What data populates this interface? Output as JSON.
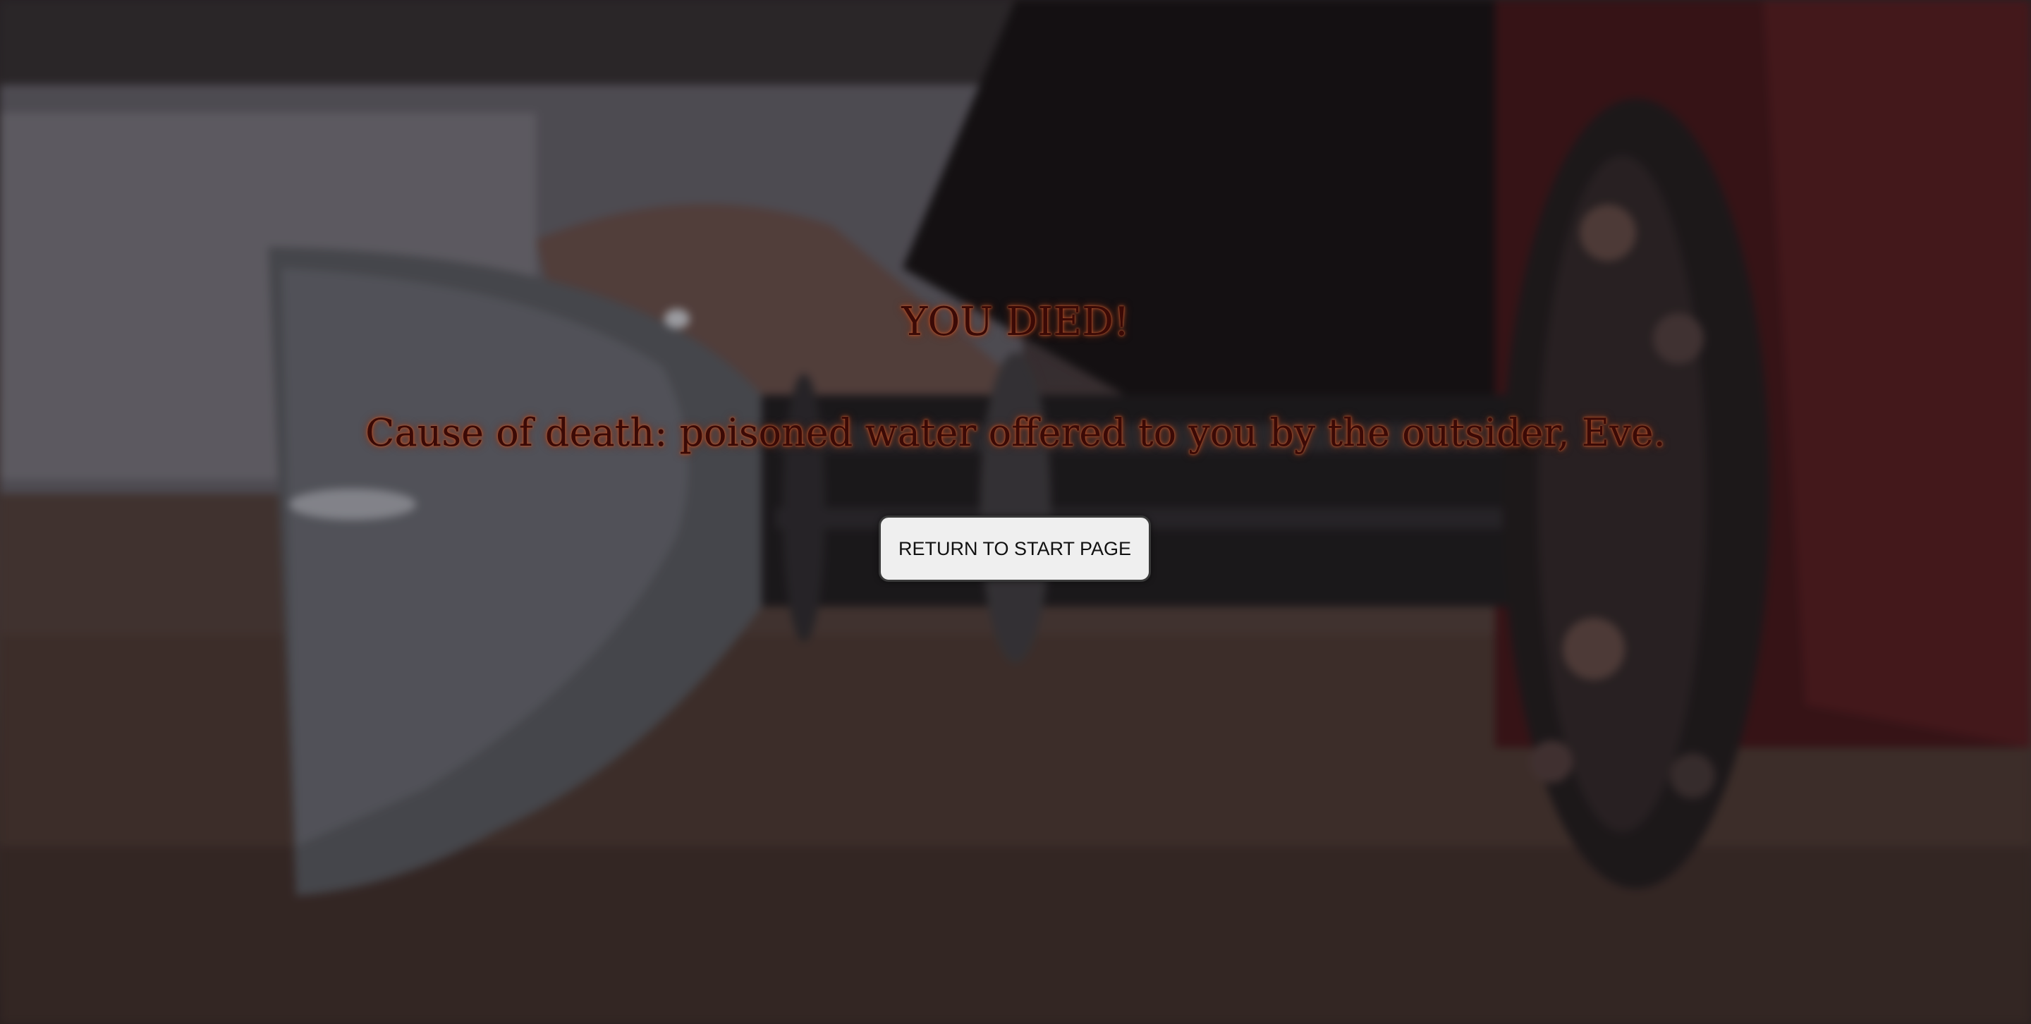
{
  "death_screen": {
    "title": "YOU DIED!",
    "cause": "Cause of death: poisoned water offered to you by the outsider, Eve.",
    "return_button_label": "RETURN TO START PAGE"
  },
  "colors": {
    "text": "#3b0a06",
    "text_glow": "#b5502a",
    "button_bg": "#efefef",
    "button_border": "#3a3a3a"
  }
}
